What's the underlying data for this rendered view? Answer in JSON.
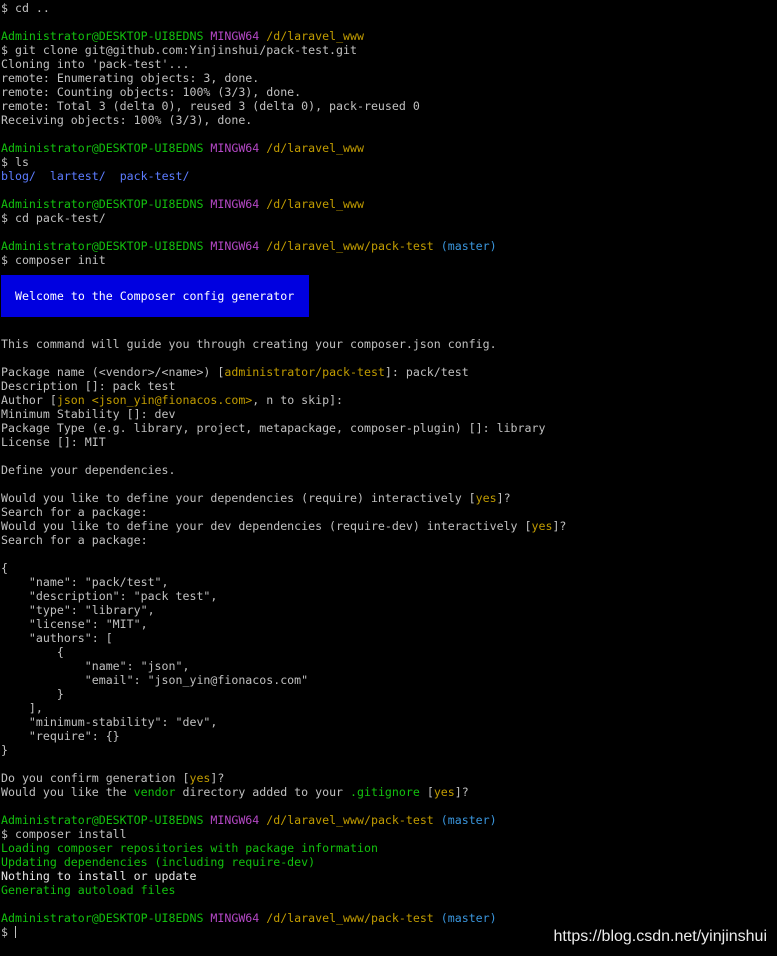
{
  "banner": "Welcome to the Composer config generator",
  "watermark": "https://blog.csdn.net/yinjinshui",
  "final_prompt": "$",
  "lines_before_banner": [
    [
      {
        "t": "$ cd ..",
        "c": "default"
      }
    ],
    [],
    [
      {
        "t": "Administrator@DESKTOP-UI8EDNS",
        "c": "green"
      },
      {
        "t": " ",
        "c": "default"
      },
      {
        "t": "MINGW64",
        "c": "magenta"
      },
      {
        "t": " ",
        "c": "default"
      },
      {
        "t": "/d/laravel_www",
        "c": "yellow"
      }
    ],
    [
      {
        "t": "$ git clone git@github.com:Yinjinshui/pack-test.git",
        "c": "default"
      }
    ],
    [
      {
        "t": "Cloning into 'pack-test'...",
        "c": "default"
      }
    ],
    [
      {
        "t": "remote: Enumerating objects: 3, done.",
        "c": "default"
      }
    ],
    [
      {
        "t": "remote: Counting objects: 100% (3/3), done.",
        "c": "default"
      }
    ],
    [
      {
        "t": "remote: Total 3 (delta 0), reused 3 (delta 0), pack-reused 0",
        "c": "default"
      }
    ],
    [
      {
        "t": "Receiving objects: 100% (3/3), done.",
        "c": "default"
      }
    ],
    [],
    [
      {
        "t": "Administrator@DESKTOP-UI8EDNS",
        "c": "green"
      },
      {
        "t": " ",
        "c": "default"
      },
      {
        "t": "MINGW64",
        "c": "magenta"
      },
      {
        "t": " ",
        "c": "default"
      },
      {
        "t": "/d/laravel_www",
        "c": "yellow"
      }
    ],
    [
      {
        "t": "$ ls",
        "c": "default"
      }
    ],
    [
      {
        "t": "blog/",
        "c": "blue"
      },
      {
        "t": "  ",
        "c": "default"
      },
      {
        "t": "lartest/",
        "c": "blue"
      },
      {
        "t": "  ",
        "c": "default"
      },
      {
        "t": "pack-test/",
        "c": "blue"
      }
    ],
    [],
    [
      {
        "t": "Administrator@DESKTOP-UI8EDNS",
        "c": "green"
      },
      {
        "t": " ",
        "c": "default"
      },
      {
        "t": "MINGW64",
        "c": "magenta"
      },
      {
        "t": " ",
        "c": "default"
      },
      {
        "t": "/d/laravel_www",
        "c": "yellow"
      }
    ],
    [
      {
        "t": "$ cd pack-test/",
        "c": "default"
      }
    ],
    [],
    [
      {
        "t": "Administrator@DESKTOP-UI8EDNS",
        "c": "green"
      },
      {
        "t": " ",
        "c": "default"
      },
      {
        "t": "MINGW64",
        "c": "magenta"
      },
      {
        "t": " ",
        "c": "default"
      },
      {
        "t": "/d/laravel_www/pack-test",
        "c": "yellow"
      },
      {
        "t": " ",
        "c": "default"
      },
      {
        "t": "(master)",
        "c": "cyan"
      }
    ],
    [
      {
        "t": "$ composer init",
        "c": "default"
      }
    ]
  ],
  "lines_after_banner": [
    [
      {
        "t": "This command will guide you through creating your composer.json config.",
        "c": "default"
      }
    ],
    [],
    [
      {
        "t": "Package name (<vendor>/<name>) [",
        "c": "default"
      },
      {
        "t": "administrator/pack-test",
        "c": "yellow"
      },
      {
        "t": "]: pack/test",
        "c": "default"
      }
    ],
    [
      {
        "t": "Description []: pack test",
        "c": "default"
      }
    ],
    [
      {
        "t": "Author [",
        "c": "default"
      },
      {
        "t": "json <json_yin@fionacos.com>",
        "c": "yellow"
      },
      {
        "t": ", n to skip]:",
        "c": "default"
      }
    ],
    [
      {
        "t": "Minimum Stability []: dev",
        "c": "default"
      }
    ],
    [
      {
        "t": "Package Type (e.g. library, project, metapackage, composer-plugin) []: library",
        "c": "default"
      }
    ],
    [
      {
        "t": "License []: MIT",
        "c": "default"
      }
    ],
    [],
    [
      {
        "t": "Define your dependencies.",
        "c": "default"
      }
    ],
    [],
    [
      {
        "t": "Would you like to define your dependencies (require) interactively [",
        "c": "default"
      },
      {
        "t": "yes",
        "c": "yellow"
      },
      {
        "t": "]?",
        "c": "default"
      }
    ],
    [
      {
        "t": "Search for a package:",
        "c": "default"
      }
    ],
    [
      {
        "t": "Would you like to define your dev dependencies (require-dev) interactively [",
        "c": "default"
      },
      {
        "t": "yes",
        "c": "yellow"
      },
      {
        "t": "]?",
        "c": "default"
      }
    ],
    [
      {
        "t": "Search for a package:",
        "c": "default"
      }
    ],
    [],
    [
      {
        "t": "{",
        "c": "default"
      }
    ],
    [
      {
        "t": "    \"name\": \"pack/test\",",
        "c": "default"
      }
    ],
    [
      {
        "t": "    \"description\": \"pack test\",",
        "c": "default"
      }
    ],
    [
      {
        "t": "    \"type\": \"library\",",
        "c": "default"
      }
    ],
    [
      {
        "t": "    \"license\": \"MIT\",",
        "c": "default"
      }
    ],
    [
      {
        "t": "    \"authors\": [",
        "c": "default"
      }
    ],
    [
      {
        "t": "        {",
        "c": "default"
      }
    ],
    [
      {
        "t": "            \"name\": \"json\",",
        "c": "default"
      }
    ],
    [
      {
        "t": "            \"email\": \"json_yin@fionacos.com\"",
        "c": "default"
      }
    ],
    [
      {
        "t": "        }",
        "c": "default"
      }
    ],
    [
      {
        "t": "    ],",
        "c": "default"
      }
    ],
    [
      {
        "t": "    \"minimum-stability\": \"dev\",",
        "c": "default"
      }
    ],
    [
      {
        "t": "    \"require\": {}",
        "c": "default"
      }
    ],
    [
      {
        "t": "}",
        "c": "default"
      }
    ],
    [],
    [
      {
        "t": "Do you confirm generation [",
        "c": "default"
      },
      {
        "t": "yes",
        "c": "yellow"
      },
      {
        "t": "]?",
        "c": "default"
      }
    ],
    [
      {
        "t": "Would you like the ",
        "c": "default"
      },
      {
        "t": "vendor",
        "c": "green"
      },
      {
        "t": " directory added to your ",
        "c": "default"
      },
      {
        "t": ".gitignore",
        "c": "green"
      },
      {
        "t": " [",
        "c": "default"
      },
      {
        "t": "yes",
        "c": "yellow"
      },
      {
        "t": "]?",
        "c": "default"
      }
    ],
    [],
    [
      {
        "t": "Administrator@DESKTOP-UI8EDNS",
        "c": "green"
      },
      {
        "t": " ",
        "c": "default"
      },
      {
        "t": "MINGW64",
        "c": "magenta"
      },
      {
        "t": " ",
        "c": "default"
      },
      {
        "t": "/d/laravel_www/pack-test",
        "c": "yellow"
      },
      {
        "t": " ",
        "c": "default"
      },
      {
        "t": "(master)",
        "c": "cyan"
      }
    ],
    [
      {
        "t": "$ composer install",
        "c": "default"
      }
    ],
    [
      {
        "t": "Loading composer repositories with package information",
        "c": "green"
      }
    ],
    [
      {
        "t": "Updating dependencies (including require-dev)",
        "c": "green"
      }
    ],
    [
      {
        "t": "Nothing to install or update",
        "c": "white"
      }
    ],
    [
      {
        "t": "Generating autoload files",
        "c": "green"
      }
    ],
    [],
    [
      {
        "t": "Administrator@DESKTOP-UI8EDNS",
        "c": "green"
      },
      {
        "t": " ",
        "c": "default"
      },
      {
        "t": "MINGW64",
        "c": "magenta"
      },
      {
        "t": " ",
        "c": "default"
      },
      {
        "t": "/d/laravel_www/pack-test",
        "c": "yellow"
      },
      {
        "t": " ",
        "c": "default"
      },
      {
        "t": "(master)",
        "c": "cyan"
      }
    ]
  ]
}
